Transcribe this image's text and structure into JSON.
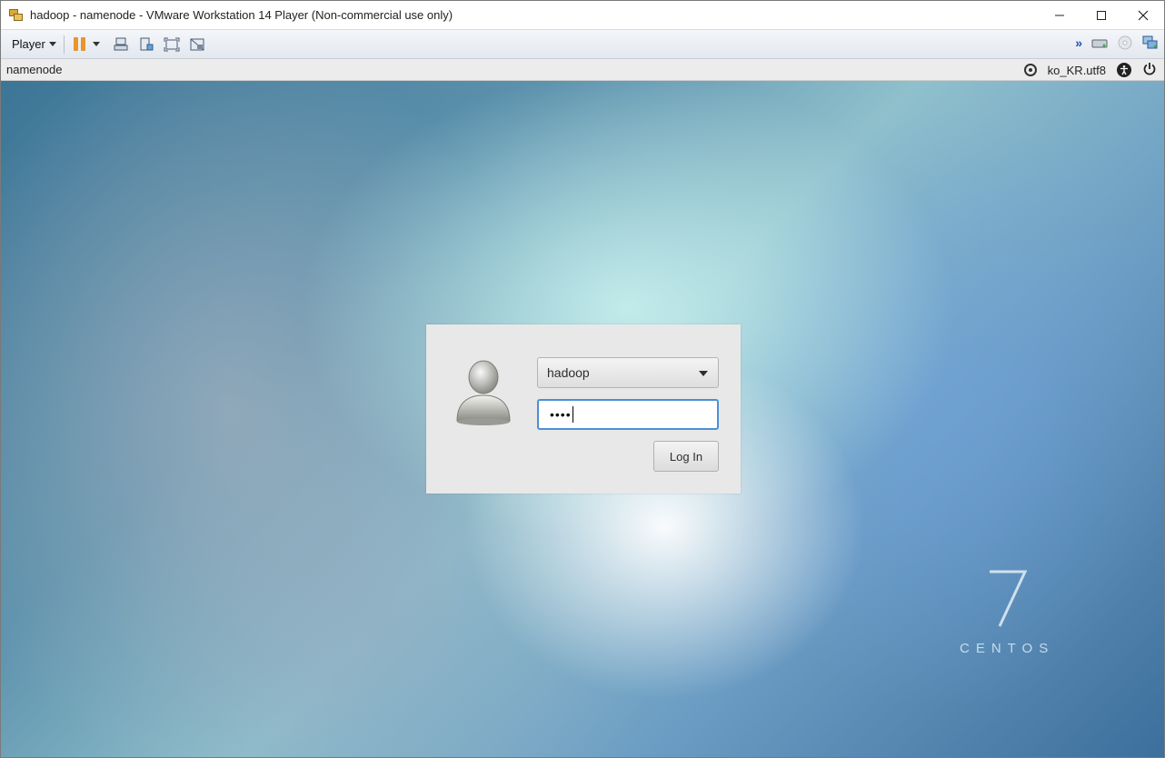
{
  "window": {
    "title": "hadoop - namenode - VMware Workstation 14 Player (Non-commercial use only)",
    "controls": {
      "minimize": "—",
      "maximize": "☐",
      "close": "✕"
    }
  },
  "toolbar": {
    "player_menu": "Player",
    "icons": [
      "pause-icon",
      "send-ctrl-alt-del-icon",
      "removable-devices-icon",
      "fullscreen-icon",
      "unity-icon"
    ],
    "right_icons": [
      "more-devices-icon",
      "hard-disk-icon",
      "cd-dvd-icon",
      "network-adapter-icon"
    ]
  },
  "guest_bar": {
    "host": "namenode",
    "locale": "ko_KR.utf8",
    "icons": [
      "input-source-icon",
      "accessibility-icon",
      "power-icon"
    ]
  },
  "login": {
    "username": "hadoop",
    "password_mask": "••••",
    "login_button": "Log In"
  },
  "branding": {
    "version": "7",
    "name": "CENTOS"
  },
  "colors": {
    "focus_border": "#4a90d9",
    "toolbar_pause": "#e8952a",
    "dialog_bg": "#e8e8e8"
  }
}
